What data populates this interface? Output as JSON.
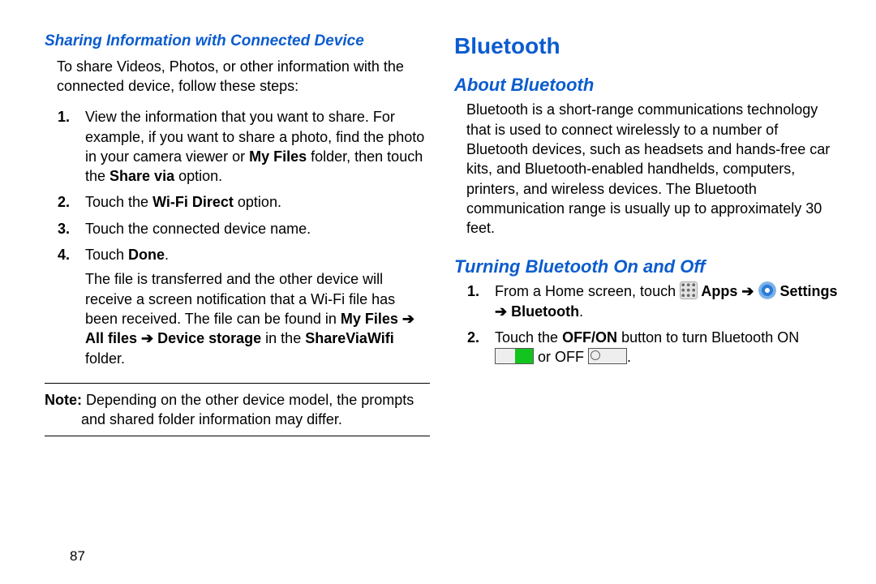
{
  "left": {
    "sharing_heading": "Sharing Information with Connected Device",
    "intro": "To share Videos, Photos, or other information with the connected device, follow these steps:",
    "step1_a": "View the information that you want to share. For example, if you want to share a photo, find the photo in your camera viewer or ",
    "my_files": "My Files",
    "step1_b": " folder, then touch the ",
    "share_via": "Share via",
    "step1_c": " option.",
    "step2_a": "Touch the ",
    "wifi_direct": "Wi-Fi Direct",
    "step2_b": " option.",
    "step3": "Touch the connected device name.",
    "step4_a": "Touch ",
    "done": "Done",
    "step4_b": ".",
    "step4_cont": "The file is transferred and the other device will receive a screen notification that a Wi-Fi file has been received. The file can be found in ",
    "my_files_arrow": "My Files ➔ All files ➔ Device storage",
    "step4_cont2": " in the ",
    "sharevia": "ShareViaWifi",
    "step4_cont3": " folder.",
    "note_label": "Note:",
    "note_text": " Depending on the other device model, the prompts and shared folder information may differ."
  },
  "right": {
    "bluetooth_heading": "Bluetooth",
    "about_heading": "About Bluetooth",
    "about_text": "Bluetooth is a short-range communications technology that is used to connect wirelessly to a number of Bluetooth devices, such as headsets and hands-free car kits, and Bluetooth-enabled handhelds, computers, printers, and wireless devices. The Bluetooth communication range is usually up to approximately 30 feet.",
    "turning_heading": "Turning Bluetooth On and Off",
    "step1_a": "From a Home screen, touch ",
    "apps": " Apps ➔ ",
    "settings": " Settings ➔ Bluetooth",
    "step1_end": ".",
    "step2_a": "Touch the ",
    "offon": "OFF/ON",
    "step2_b": " button to turn Bluetooth ON ",
    "or_off": " or OFF ",
    "period": "."
  },
  "nums": {
    "n1": "1.",
    "n2": "2.",
    "n3": "3.",
    "n4": "4."
  },
  "page_number": "87"
}
